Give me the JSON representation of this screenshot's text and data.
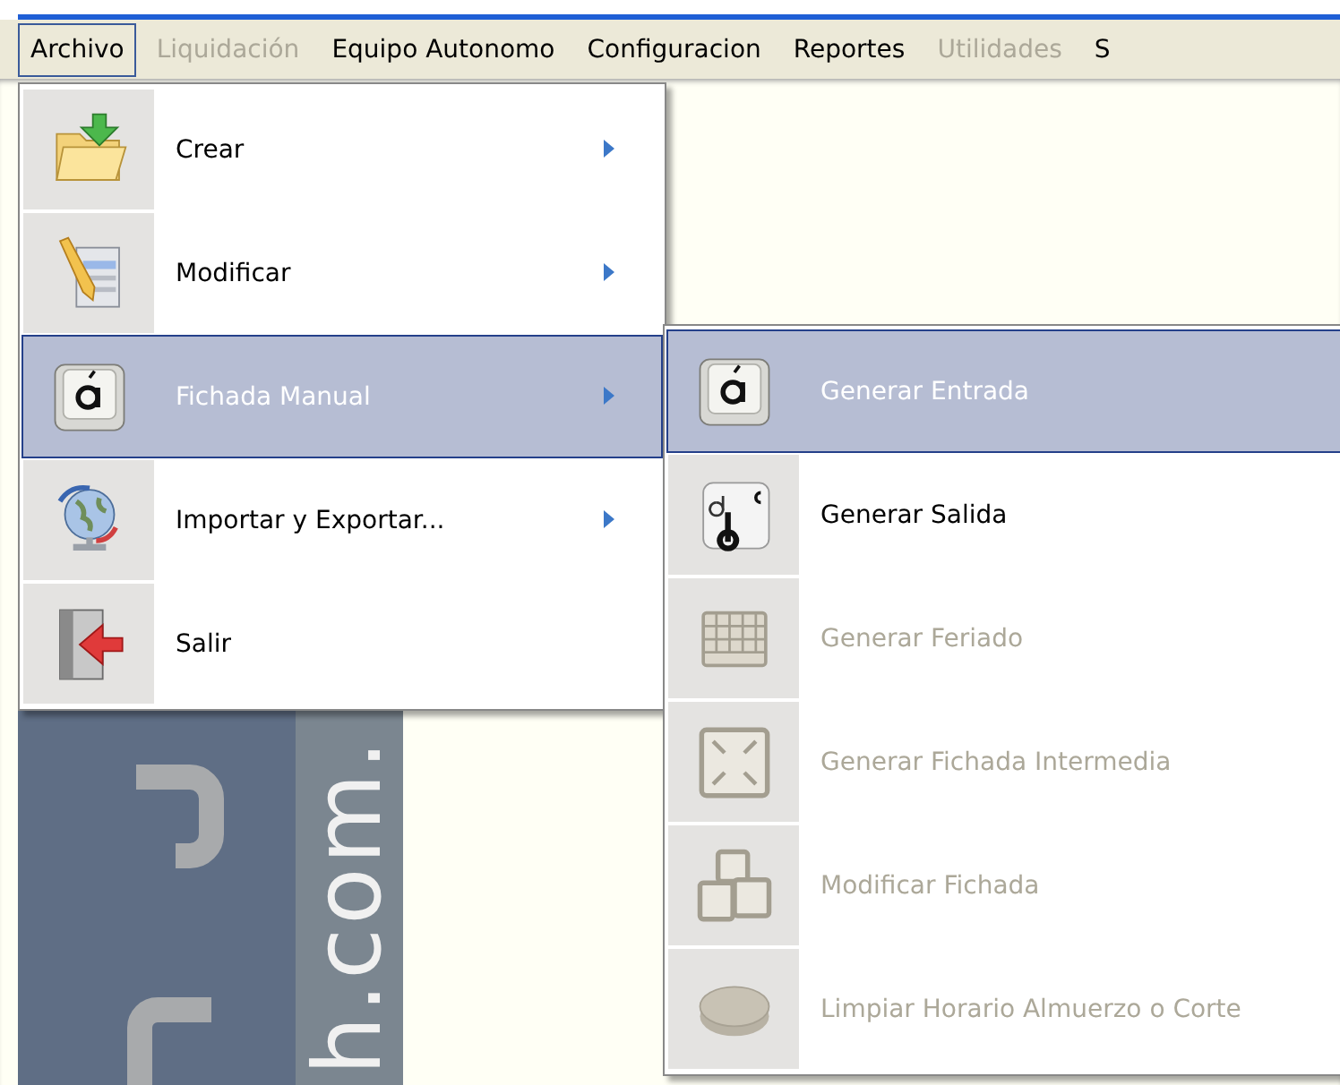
{
  "menubar": [
    {
      "label": "Archivo",
      "selected": true,
      "disabled": false
    },
    {
      "label": "Liquidación",
      "selected": false,
      "disabled": true
    },
    {
      "label": "Equipo Autonomo",
      "selected": false,
      "disabled": false
    },
    {
      "label": "Configuracion",
      "selected": false,
      "disabled": false
    },
    {
      "label": "Reportes",
      "selected": false,
      "disabled": false
    },
    {
      "label": "Utilidades",
      "selected": false,
      "disabled": true
    },
    {
      "label": "S",
      "selected": false,
      "disabled": false
    }
  ],
  "menu": {
    "items": [
      {
        "label": "Crear",
        "submenu": true,
        "selected": false
      },
      {
        "label": "Modificar",
        "submenu": true,
        "selected": false
      },
      {
        "label": "Fichada Manual",
        "submenu": true,
        "selected": true
      },
      {
        "label": "Importar y Exportar...",
        "submenu": true,
        "selected": false
      },
      {
        "label": "Salir",
        "submenu": false,
        "selected": false
      }
    ]
  },
  "submenu": {
    "items": [
      {
        "label": "Generar Entrada",
        "selected": true,
        "disabled": false
      },
      {
        "label": "Generar Salida",
        "selected": false,
        "disabled": false
      },
      {
        "label": "Generar Feriado",
        "selected": false,
        "disabled": true
      },
      {
        "label": "Generar Fichada Intermedia",
        "selected": false,
        "disabled": true
      },
      {
        "label": "Modificar Fichada",
        "selected": false,
        "disabled": true
      },
      {
        "label": "Limpiar Horario Almuerzo o Corte",
        "selected": false,
        "disabled": true
      }
    ]
  },
  "background": {
    "logo_text": "h.com."
  }
}
